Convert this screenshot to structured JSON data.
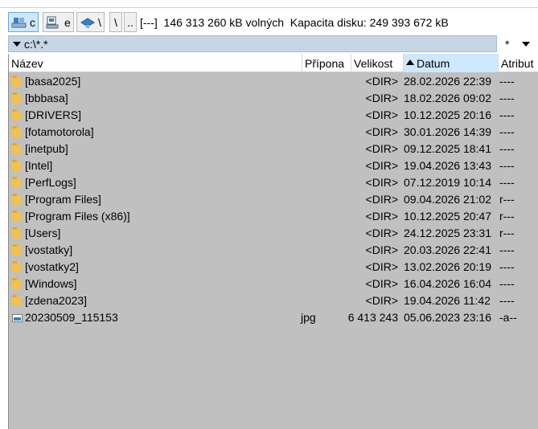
{
  "drives": [
    {
      "letter": "c",
      "active": true,
      "icon": "hard-drive-icon"
    },
    {
      "letter": "e",
      "active": false,
      "icon": "network-drive-icon"
    },
    {
      "letter": "\\",
      "active": false,
      "icon": "network-places-icon"
    }
  ],
  "nav": {
    "root_label": "\\",
    "up_label": ".."
  },
  "disk_info": {
    "drive_label": "[---]",
    "free_text": "146 313 260 kB volných",
    "capacity_text": "Kapacita disku: 249 393 672 kB"
  },
  "path": {
    "value": "c:\\*.*",
    "filter": "*"
  },
  "columns": {
    "name": "Název",
    "ext": "Přípona",
    "size": "Velikost",
    "date": "Datum",
    "attr": "Atribut"
  },
  "sort": {
    "column": "date",
    "direction": "ascending"
  },
  "files": [
    {
      "name": "[basa2025]",
      "ext": "",
      "size": "<DIR>",
      "date": "28.02.2026 22:39",
      "attr": "----",
      "type": "folder"
    },
    {
      "name": "[bbbasa]",
      "ext": "",
      "size": "<DIR>",
      "date": "18.02.2026 09:02",
      "attr": "----",
      "type": "folder"
    },
    {
      "name": "[DRIVERS]",
      "ext": "",
      "size": "<DIR>",
      "date": "10.12.2025 20:16",
      "attr": "----",
      "type": "folder"
    },
    {
      "name": "[fotamotorola]",
      "ext": "",
      "size": "<DIR>",
      "date": "30.01.2026 14:39",
      "attr": "----",
      "type": "folder"
    },
    {
      "name": "[inetpub]",
      "ext": "",
      "size": "<DIR>",
      "date": "09.12.2025 18:41",
      "attr": "----",
      "type": "folder"
    },
    {
      "name": "[Intel]",
      "ext": "",
      "size": "<DIR>",
      "date": "19.04.2026 13:43",
      "attr": "----",
      "type": "folder"
    },
    {
      "name": "[PerfLogs]",
      "ext": "",
      "size": "<DIR>",
      "date": "07.12.2019 10:14",
      "attr": "----",
      "type": "folder"
    },
    {
      "name": "[Program Files]",
      "ext": "",
      "size": "<DIR>",
      "date": "09.04.2026 21:02",
      "attr": "r---",
      "type": "folder"
    },
    {
      "name": "[Program Files (x86)]",
      "ext": "",
      "size": "<DIR>",
      "date": "10.12.2025 20:47",
      "attr": "r---",
      "type": "folder"
    },
    {
      "name": "[Users]",
      "ext": "",
      "size": "<DIR>",
      "date": "24.12.2025 23:31",
      "attr": "r---",
      "type": "folder"
    },
    {
      "name": "[vostatky]",
      "ext": "",
      "size": "<DIR>",
      "date": "20.03.2026 22:41",
      "attr": "----",
      "type": "folder"
    },
    {
      "name": "[vostatky2]",
      "ext": "",
      "size": "<DIR>",
      "date": "13.02.2026 20:19",
      "attr": "----",
      "type": "folder"
    },
    {
      "name": "[Windows]",
      "ext": "",
      "size": "<DIR>",
      "date": "16.04.2026 16:04",
      "attr": "----",
      "type": "folder"
    },
    {
      "name": "[zdena2023]",
      "ext": "",
      "size": "<DIR>",
      "date": "19.04.2026 11:42",
      "attr": "----",
      "type": "folder"
    },
    {
      "name": "20230509_115153",
      "ext": "jpg",
      "size": "6 413 243",
      "date": "05.06.2023 23:16",
      "attr": "-a--",
      "type": "image"
    }
  ],
  "colors": {
    "panel_bg": "#c0c0c0",
    "path_bg": "#c6d6e4",
    "sorted_header_bg": "#cde8ff",
    "folder": "#f2c14e"
  }
}
